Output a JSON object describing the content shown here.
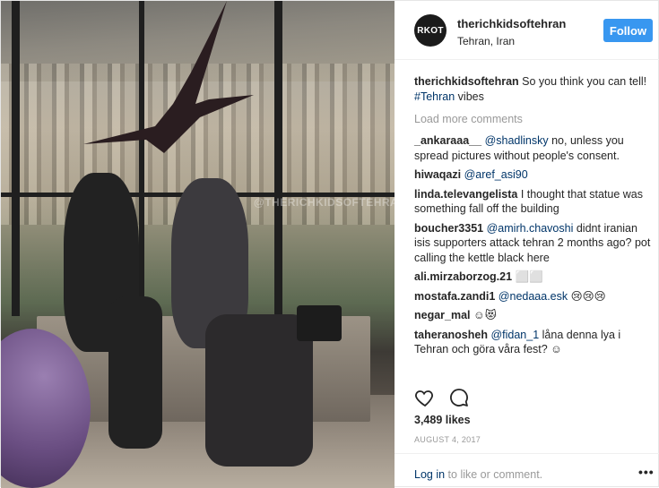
{
  "post": {
    "photo": {
      "watermark": "@THERICHKIDSOFTEHRAN"
    },
    "header": {
      "avatar_text": "RKOT",
      "username": "therichkidsoftehran",
      "location": "Tehran, Iran",
      "follow_label": "Follow"
    },
    "caption": {
      "username": "therichkidsoftehran",
      "text": "So you think you can tell!",
      "hashtag": "#Tehran",
      "text_after": "vibes"
    },
    "load_more": "Load more comments",
    "comments": [
      {
        "user": "_ankaraaa__",
        "mention": "@shadlinsky",
        "text": "no, unless you spread pictures without people's consent."
      },
      {
        "user": "hiwaqazi",
        "mention": "@aref_asi90",
        "text": ""
      },
      {
        "user": "linda.televangelista",
        "mention": "",
        "text": "I thought that statue was something fall off the building"
      },
      {
        "user": "boucher3351",
        "mention": "@amirh.chavoshi",
        "text": "didnt iranian isis supporters attack tehran 2 months ago? pot calling the kettle black here"
      },
      {
        "user": "ali.mirzaborzog.21",
        "mention": "",
        "text": "⬜⬜"
      },
      {
        "user": "mostafa.zandi1",
        "mention": "@nedaaa.esk",
        "text": "😢😢😢"
      },
      {
        "user": "negar_mal",
        "mention": "",
        "text": "☺😻"
      },
      {
        "user": "taheranosheh",
        "mention": "@fidan_1",
        "text": "låna denna lya i Tehran och göra våra fest? ☺"
      }
    ],
    "likes": "3,489 likes",
    "date": "AUGUST 4, 2017",
    "footer": {
      "login_link": "Log in",
      "login_text": "to like or comment.",
      "more": "•••"
    },
    "icons": {
      "like": "heart-icon",
      "comment": "comment-bubble-icon",
      "options": "more-options-icon"
    },
    "colors": {
      "follow_button": "#3897f0",
      "link": "#003569",
      "muted": "#999999"
    }
  }
}
